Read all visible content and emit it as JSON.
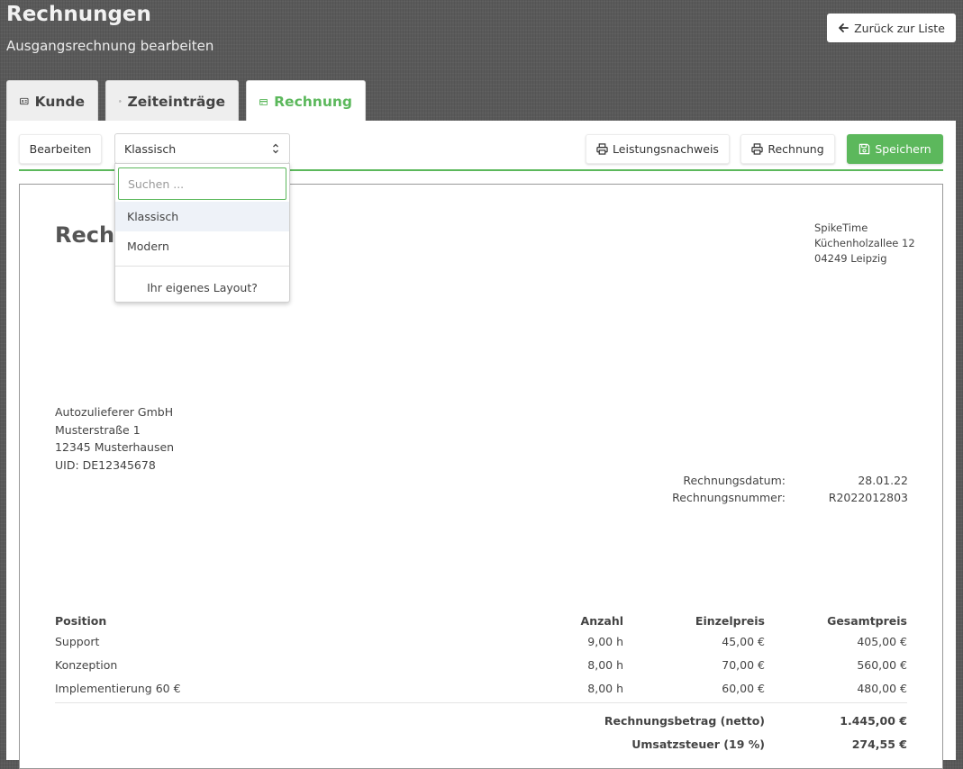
{
  "header": {
    "title": "Rechnungen",
    "subtitle": "Ausgangsrechnung bearbeiten",
    "back_label": "Zurück zur Liste"
  },
  "tabs": [
    {
      "label": "Kunde",
      "icon": "id-card-icon"
    },
    {
      "label": "Zeiteinträge",
      "icon": "clock-icon"
    },
    {
      "label": "Rechnung",
      "icon": "credit-card-icon",
      "active": true
    }
  ],
  "toolbar": {
    "edit_label": "Bearbeiten",
    "layout_value": "Klassisch",
    "proof_label": "Leistungsnachweis",
    "invoice_label": "Rechnung",
    "save_label": "Speichern"
  },
  "dropdown": {
    "placeholder": "Suchen ...",
    "options": [
      "Klassisch",
      "Modern"
    ],
    "selected": "Klassisch",
    "footer": "Ihr eigenes Layout?"
  },
  "document": {
    "title": "Rechnung",
    "sender": [
      "SpikeTime",
      "Küchenholzallee 12",
      "04249 Leipzig"
    ],
    "recipient": [
      "Autozulieferer GmbH",
      "Musterstraße 1",
      "12345 Musterhausen",
      "UID: DE12345678"
    ],
    "meta": [
      {
        "label": "Rechnungsdatum:",
        "value": "28.01.22"
      },
      {
        "label": "Rechnungsnummer:",
        "value": "R2022012803"
      }
    ],
    "columns": [
      "Position",
      "Anzahl",
      "Einzelpreis",
      "Gesamtpreis"
    ],
    "items": [
      [
        "Support",
        "9,00 h",
        "45,00 €",
        "405,00 €"
      ],
      [
        "Konzeption",
        "8,00 h",
        "70,00 €",
        "560,00 €"
      ],
      [
        "Implementierung 60 €",
        "8,00 h",
        "60,00 €",
        "480,00 €"
      ]
    ],
    "totals": [
      {
        "label": "Rechnungsbetrag (netto)",
        "value": "1.445,00 €"
      },
      {
        "label": "Umsatzsteuer (19 %)",
        "value": "274,55 €"
      }
    ]
  },
  "colors": {
    "accent": "#5cb85c",
    "selected_option": "#eef2f8"
  }
}
